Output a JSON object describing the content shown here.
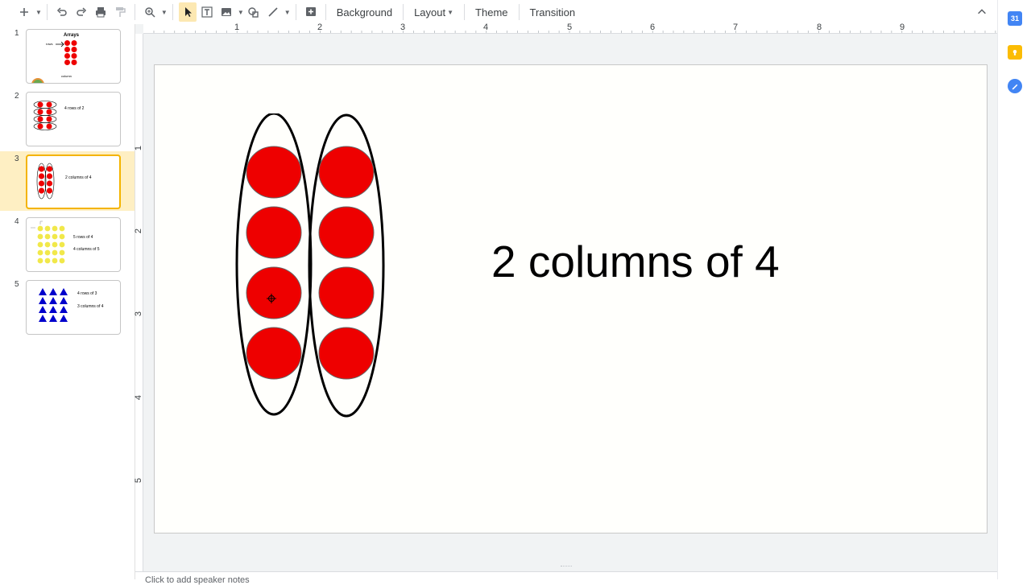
{
  "toolbar": {
    "background_label": "Background",
    "layout_label": "Layout",
    "theme_label": "Theme",
    "transition_label": "Transition"
  },
  "filmstrip": {
    "slides": [
      {
        "number": "1",
        "title": "Arrays",
        "label_a": "rows",
        "label_b": "column"
      },
      {
        "number": "2",
        "text": "4 rows of 2"
      },
      {
        "number": "3",
        "text": "2 columns of 4"
      },
      {
        "number": "4",
        "text_a": "5 rows of 4",
        "text_b": "4 columns of 5"
      },
      {
        "number": "5",
        "text_a": "4 rows of 3",
        "text_b": "3 columns of 4"
      }
    ]
  },
  "ruler": {
    "h": [
      "1",
      "2",
      "3",
      "4",
      "5",
      "6",
      "7",
      "8",
      "9"
    ],
    "v": [
      "1",
      "2",
      "3",
      "4",
      "5"
    ]
  },
  "slide": {
    "title": "2 columns of 4",
    "circle_color": "#ee0000",
    "column_count": 2,
    "dots_per_column": 4
  },
  "notes": {
    "placeholder": "Click to add speaker notes"
  },
  "colors": {
    "accent_yellow": "#f4b400",
    "selected_bg": "#feefc3"
  }
}
